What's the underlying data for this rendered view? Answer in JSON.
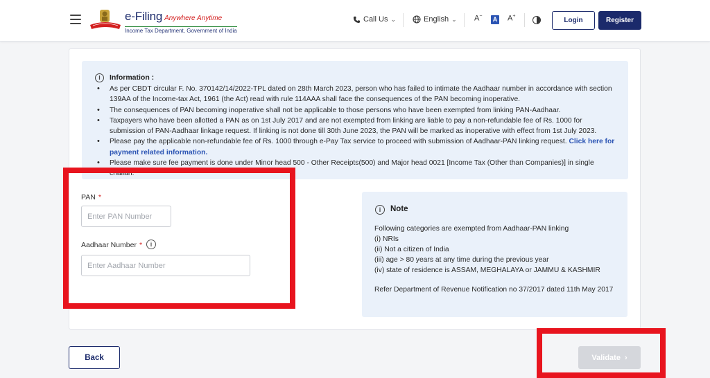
{
  "header": {
    "brand_title": "e-Filing",
    "brand_tagline": "Anywhere Anytime",
    "brand_subtitle": "Income Tax Department, Government of India",
    "call_us": "Call Us",
    "language": "English",
    "font_decrease": "A",
    "font_normal": "A",
    "font_increase": "A",
    "login": "Login",
    "register": "Register"
  },
  "info": {
    "title": "Information :",
    "items": [
      "As per CBDT circular F. No. 370142/14/2022-TPL dated on 28th March 2023, person who has failed to intimate the Aadhaar number in accordance with section 139AA of the Income-tax Act, 1961 (the Act) read with rule 114AAA shall face the consequences of the PAN becoming inoperative.",
      "The consequences of PAN becoming inoperative shall not be applicable to those persons who have been exempted from linking PAN-Aadhaar.",
      "Taxpayers who have been allotted a PAN as on 1st July 2017 and are not exempted from linking are liable to pay a non-refundable fee of Rs. 1000 for submission of PAN-Aadhaar linkage request. If linking is not done till 30th June 2023, the PAN will be marked as inoperative with effect from 1st July 2023.",
      "Please pay the applicable non-refundable fee of Rs. 1000 through e-Pay Tax service to proceed with submission of Aadhaar-PAN linking request.",
      "Please make sure fee payment is done under Minor head 500 - Other Receipts(500) and Major head 0021 [Income Tax (Other than Companies)] in single challan."
    ],
    "link_text": "Click here for payment related information."
  },
  "form": {
    "pan_label": "PAN",
    "pan_placeholder": "Enter PAN Number",
    "aadhaar_label": "Aadhaar Number",
    "aadhaar_placeholder": "Enter Aadhaar Number",
    "required_mark": "*"
  },
  "note": {
    "title": "Note",
    "intro": "Following categories are exempted from Aadhaar-PAN linking",
    "items": [
      "(i) NRIs",
      "(ii) Not a citizen of India",
      "(iii) age > 80 years at any time during the previous year",
      "(iv) state of residence is ASSAM, MEGHALAYA or JAMMU & KASHMIR"
    ],
    "reference": "Refer Department of Revenue Notification no 37/2017 dated 11th May 2017"
  },
  "actions": {
    "back": "Back",
    "validate": "Validate",
    "validate_arrow": "›"
  },
  "colors": {
    "brand_navy": "#1b2a6b",
    "highlight_red": "#e8141e",
    "info_bg": "#eaf1fa",
    "link_blue": "#2c55b4",
    "disabled_gray": "#d5d7dc"
  },
  "icons": [
    "menu-icon",
    "emblem-logo",
    "phone-icon",
    "globe-icon",
    "contrast-icon",
    "info-icon",
    "help-icon",
    "chevron-right-icon"
  ]
}
